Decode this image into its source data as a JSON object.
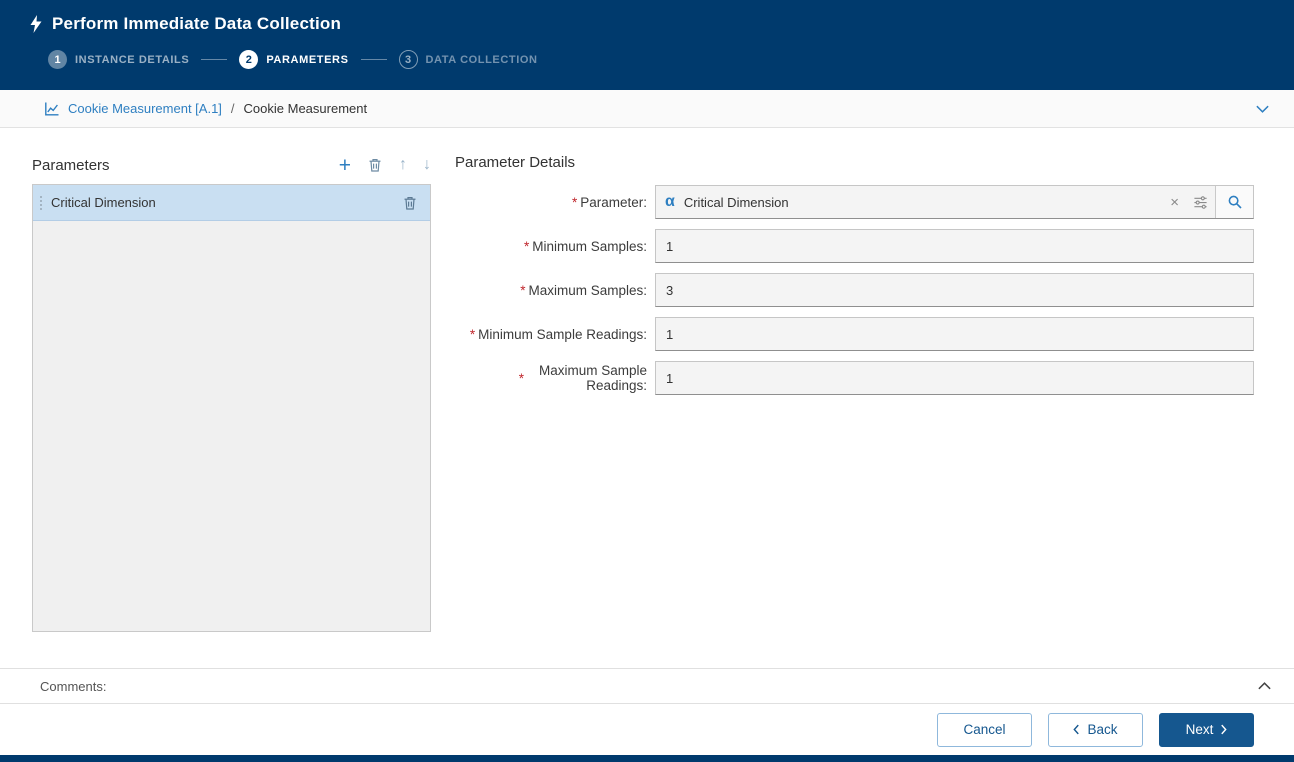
{
  "ui": {
    "required_marker": "*"
  },
  "header": {
    "title": "Perform Immediate Data Collection",
    "steps": [
      {
        "number": "1",
        "label": "INSTANCE DETAILS",
        "state": "done"
      },
      {
        "number": "2",
        "label": "PARAMETERS",
        "state": "active"
      },
      {
        "number": "3",
        "label": "DATA COLLECTION",
        "state": "pending"
      }
    ]
  },
  "breadcrumb": {
    "link": "Cookie Measurement [A.1]",
    "separator": "/",
    "current": "Cookie Measurement"
  },
  "parameters_panel": {
    "title": "Parameters",
    "toolbar": {
      "add": "+",
      "move_up": "↑",
      "move_down": "↓"
    },
    "items": [
      {
        "label": "Critical Dimension",
        "selected": true
      }
    ]
  },
  "details_panel": {
    "title": "Parameter Details",
    "parameter_field": {
      "label": "Parameter:",
      "value": "Critical Dimension",
      "type_glyph": "α",
      "clear_glyph": "×"
    },
    "fields": [
      {
        "label": "Minimum Samples:",
        "value": "1"
      },
      {
        "label": "Maximum Samples:",
        "value": "3"
      },
      {
        "label": "Minimum Sample Readings:",
        "value": "1"
      },
      {
        "label": "Maximum Sample Readings:",
        "value": "1"
      }
    ]
  },
  "comments": {
    "label": "Comments:"
  },
  "footer": {
    "cancel_label": "Cancel",
    "back_label": "Back",
    "next_label": "Next"
  },
  "colors": {
    "header_bg": "#003a6d",
    "accent": "#2e7fc1",
    "primary_button": "#15578f",
    "selected_row": "#c9dff2",
    "required": "#c0262c"
  }
}
